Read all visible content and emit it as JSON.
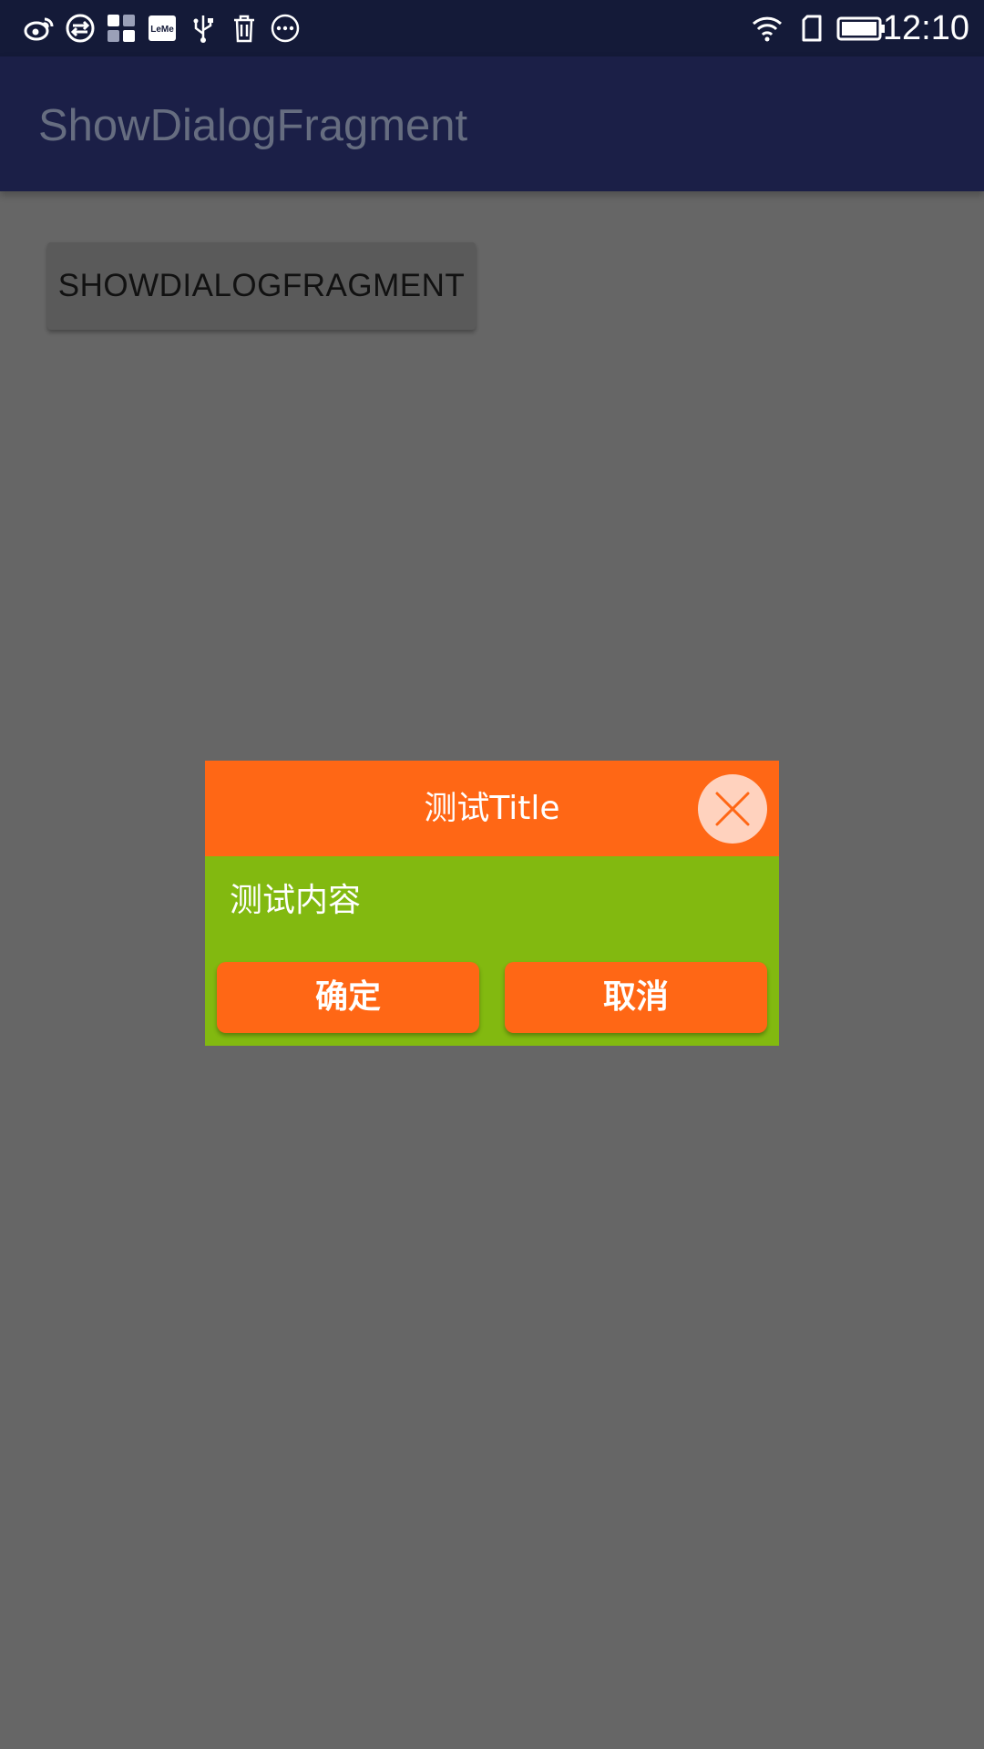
{
  "status_bar": {
    "time": "12:10",
    "left_icons": [
      "weibo-icon",
      "sync-icon",
      "apps-grid-icon",
      "leme-icon",
      "usb-icon",
      "trash-icon",
      "more-icon"
    ],
    "right_icons": [
      "wifi-icon",
      "sim-card-icon",
      "battery-icon"
    ],
    "leme_text": "LeMe"
  },
  "app_bar": {
    "title": "ShowDialogFragment"
  },
  "main": {
    "show_button_label": "SHOWDIALOGFRAGMENT"
  },
  "dialog": {
    "title": "测试Title",
    "content": "测试内容",
    "ok_label": "确定",
    "cancel_label": "取消",
    "close_icon": "close-icon"
  },
  "colors": {
    "status_bar": "#141a38",
    "app_bar": "#1b1f47",
    "scrim_background": "#666666",
    "dialog_header": "#ff6715",
    "dialog_body": "#82b910",
    "dialog_buttons": "#ff6715",
    "close_button_bg": "#ffd2be"
  }
}
